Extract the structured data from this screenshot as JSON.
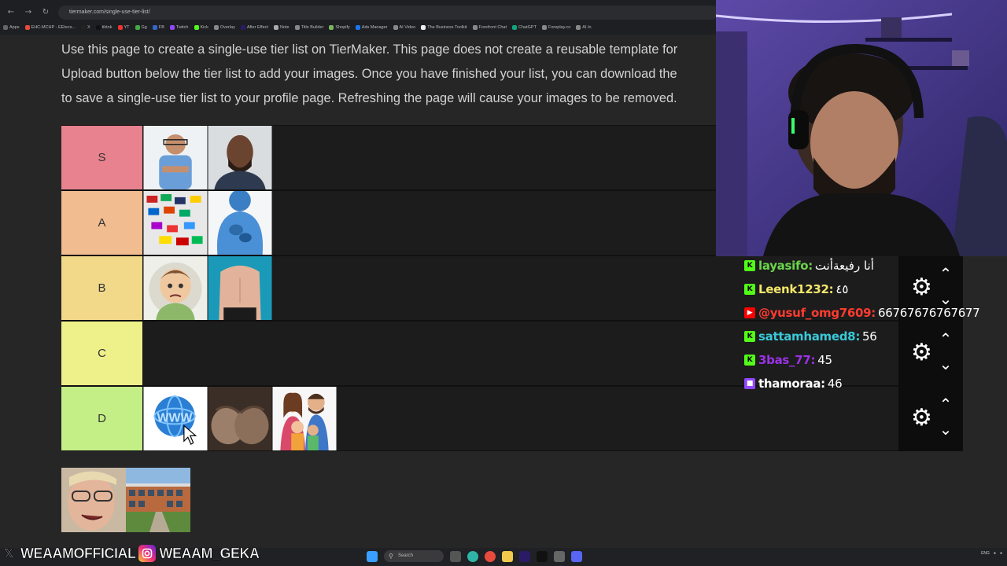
{
  "browser": {
    "url": "tiermaker.com/single-use-tier-list/",
    "bookmarks": [
      "Apps",
      "EHC-MCHP - EEtecs...",
      "X",
      "tiktok",
      "YT",
      "Gg",
      "FB",
      "Twitch",
      "Kick",
      "Overlay",
      "After Effect",
      "Note",
      "Title Builder",
      "Shopify",
      "Ads Manager",
      "AI Video",
      "The Business Toolkit",
      "Forefront Chat",
      "ChatGPT",
      "Foreplay.co",
      "AI In"
    ]
  },
  "intro": {
    "line1": "Use this page to create a single-use tier list on TierMaker. This page does not create a reusable template for",
    "line2": "Upload button below the tier list to add your images. Once you have finished your list, you can download the",
    "line3": "to save a single-use tier list to your profile page. Refreshing the page will cause your images to be removed."
  },
  "tiers": [
    {
      "label": "S",
      "color": "#e8828f",
      "items": [
        "boy-portrait",
        "man-portrait"
      ]
    },
    {
      "label": "A",
      "color": "#f0bc90",
      "items": [
        "flags-pile",
        "anatomy-body"
      ]
    },
    {
      "label": "B",
      "color": "#f2d98a",
      "items": [
        "cartoon-boy",
        "torso-photo"
      ]
    },
    {
      "label": "C",
      "color": "#eef08a",
      "items": []
    },
    {
      "label": "D",
      "color": "#c4ee86",
      "items": [
        "www-globe",
        "open-hands",
        "family-cartoon"
      ]
    }
  ],
  "pool": [
    "face-closeup",
    "school-building"
  ],
  "chat": [
    {
      "platform": "kick",
      "user": "layasifo:",
      "msg": "أنا رفيعةأنت",
      "user_color": "#6bd64a"
    },
    {
      "platform": "kick",
      "user": "Leenk1232:",
      "msg": "٤٥",
      "user_color": "#f5e66a"
    },
    {
      "platform": "youtube",
      "user": "@yusuf_omg7609:",
      "msg": "66767676767677",
      "user_color": "#ff3b30"
    },
    {
      "platform": "kick",
      "user": "sattamhamed8:",
      "msg": "56",
      "user_color": "#39c9d9"
    },
    {
      "platform": "kick",
      "user": "3bas_77:",
      "msg": "45",
      "user_color": "#9b32e6"
    },
    {
      "platform": "twitch",
      "user": "thamoraa:",
      "msg": "46",
      "user_color": "#ffffff"
    }
  ],
  "social": {
    "x_handle": "WEAAMOFFICIAL",
    "ig_handle": "WEAAM_GEKA"
  },
  "taskbar": {
    "search": "Search",
    "tray_lang": "ENG"
  }
}
